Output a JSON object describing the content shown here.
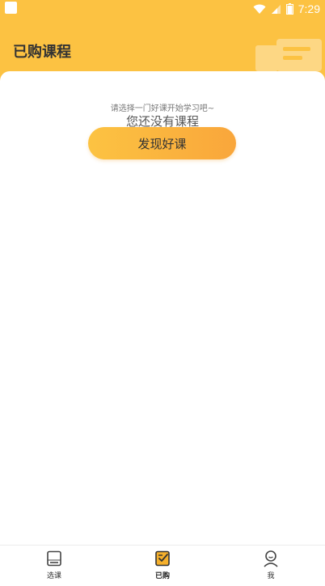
{
  "status_bar": {
    "time": "7:29"
  },
  "header": {
    "title": "已购课程"
  },
  "empty_state": {
    "hint": "请选择一门好课开始学习吧~",
    "title": "您还没有课程",
    "button_label": "发现好课"
  },
  "tabbar": {
    "tabs": [
      {
        "label": "选课",
        "icon": "book-icon"
      },
      {
        "label": "已购",
        "icon": "purchased-notebook-icon",
        "active": true
      },
      {
        "label": "我",
        "icon": "profile-icon"
      }
    ]
  },
  "colors": {
    "header_bg": "#FCC242",
    "button_gradient_start": "#FCC342",
    "button_gradient_end": "#F9A63B",
    "active_icon_accent": "#F5B02C"
  }
}
